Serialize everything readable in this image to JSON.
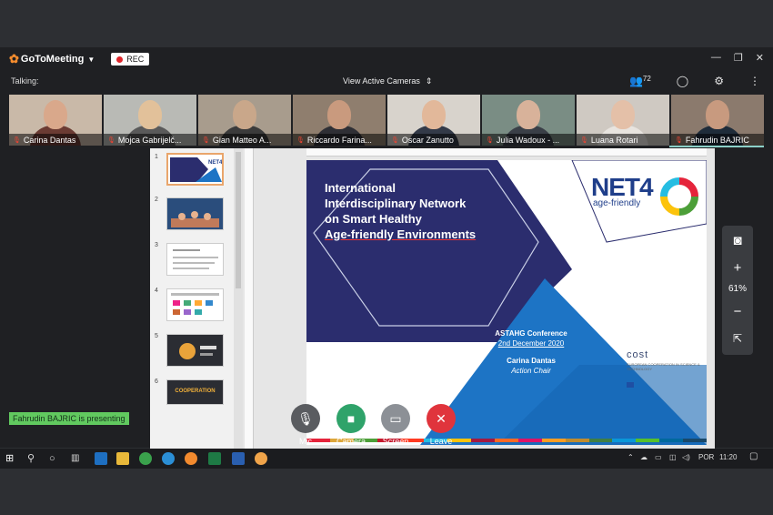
{
  "app": {
    "name": "GoToMeeting",
    "rec_label": "REC",
    "talking_label": "Talking:",
    "view_label": "View Active Cameras",
    "attendee_count": "72",
    "presenting_label": "Fahrudin BAJRIC is presenting"
  },
  "participants": [
    {
      "name": "Carina Dantas",
      "bg": "#c9b9a8",
      "skin": "#d9a88b",
      "shirt": "#6b3b33"
    },
    {
      "name": "Mojca Gabrijelč...",
      "bg": "#b9bab5",
      "skin": "#e2c19a",
      "shirt": "#5a5a5a"
    },
    {
      "name": "Gian Matteo A...",
      "bg": "#a89c8d",
      "skin": "#c9a78a",
      "shirt": "#3b3b3b"
    },
    {
      "name": "Riccardo Farina...",
      "bg": "#8f7e6e",
      "skin": "#c99a7e",
      "shirt": "#2f2f35"
    },
    {
      "name": "Oscar Zanutto",
      "bg": "#d8d3cc",
      "skin": "#e2b89a",
      "shirt": "#333a48"
    },
    {
      "name": "Julia Wadoux - ...",
      "bg": "#7a8d84",
      "skin": "#d8b29a",
      "shirt": "#3a3f47"
    },
    {
      "name": "Luana Rotari",
      "bg": "#cfc9c2",
      "skin": "#e4c0a8",
      "shirt": "#e8e4df"
    },
    {
      "name": "Fahrudin BAJRIC",
      "bg": "#8b7a6d",
      "skin": "#c89a7f",
      "shirt": "#1f2c3a"
    }
  ],
  "slide": {
    "title_lines": [
      "International",
      "Interdisciplinary Network",
      "on Smart Healthy",
      "Age-friendly Environments"
    ],
    "logo_net": "NET4",
    "logo_sub": "age-friendly",
    "conference": "ASTAHG Conference",
    "date": "2nd December 2020",
    "presenter": "Carina Dantas",
    "role": "Action Chair",
    "cost_logo": "cost",
    "cost_sub": "EUROPEAN COOPERATION IN SCIENCE & TECHNOLOGY"
  },
  "slide_numbers": [
    "1",
    "2",
    "3",
    "4",
    "5",
    "6"
  ],
  "thumb6_text": "COOPERATION",
  "zoom": {
    "percent": "61%"
  },
  "controls": [
    {
      "label": "Mic",
      "color": "#5a5c60"
    },
    {
      "label": "Camera",
      "color": "#2fa36a"
    },
    {
      "label": "Screen",
      "color": "#8c9096"
    },
    {
      "label": "Leave",
      "color": "#e0343c"
    }
  ],
  "taskbar": {
    "lang": "POR",
    "time": "11:20"
  },
  "colors": {
    "accent": "#f68d2e",
    "navy": "#2b2d6e",
    "blue": "#1d74c5"
  }
}
